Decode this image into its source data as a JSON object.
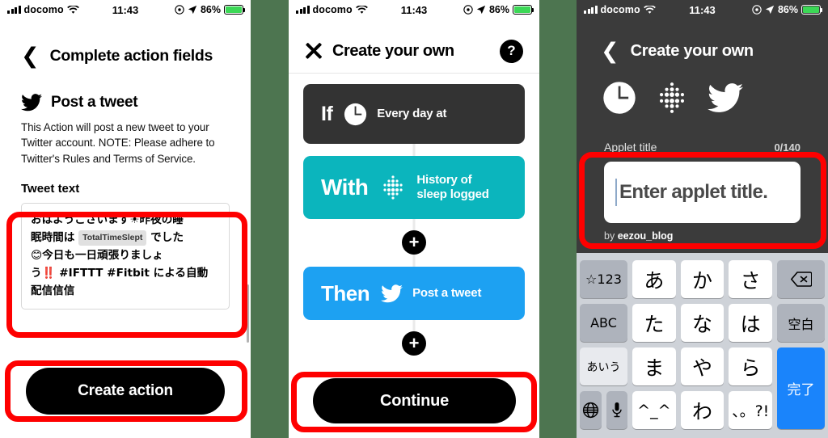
{
  "status_bar": {
    "carrier": "docomo",
    "time": "11:43",
    "battery_pct": "86%",
    "signal_icon": "cellular-bars-icon",
    "wifi_icon": "wifi-icon",
    "alarm_icon": "alarm-icon",
    "location_icon": "location-arrow-icon",
    "battery_icon": "battery-charging-icon"
  },
  "panel1": {
    "back_icon": "chevron-left-icon",
    "title": "Complete action fields",
    "service_icon": "twitter-bird-icon",
    "action_title": "Post a tweet",
    "description": "This Action will post a new tweet to your Twitter account. NOTE: Please adhere to Twitter's Rules and Terms of Service.",
    "field_label": "Tweet text",
    "tweet": {
      "line1_a": "おはようございます",
      "line1_sun": "☀",
      "line1_b": "昨夜の睡",
      "line2_a": "眠時間は",
      "ingredient": "TotalTimeSlept",
      "line2_b": "でした",
      "line3_emoji": "😊",
      "line3": "今日も一日頑張りましょ",
      "line4_a": "う",
      "line4_bangs": "‼️",
      "line4_b": "#IFTTT #Fitbit による自動",
      "line5": "配信信信"
    },
    "submit_label": "Create action"
  },
  "panel2": {
    "close_icon": "close-x-icon",
    "title": "Create your own",
    "help_label": "?",
    "cards": [
      {
        "keyword": "If",
        "service_icon": "clock-icon",
        "text": "Every day at",
        "color": "#333333"
      },
      {
        "keyword": "With",
        "service_icon": "fitbit-icon",
        "text": "History of\nsleep logged",
        "color": "#0bb5bd",
        "text_line1": "History of",
        "text_line2": "sleep logged"
      },
      {
        "keyword": "Then",
        "service_icon": "twitter-bird-icon",
        "text": "Post a tweet",
        "color": "#1da1f2"
      }
    ],
    "add_label": "+",
    "submit_label": "Continue"
  },
  "panel3": {
    "back_icon": "chevron-left-icon",
    "title": "Create your own",
    "service_icons": [
      "clock-icon",
      "fitbit-icon",
      "twitter-bird-icon"
    ],
    "field_label": "Applet title",
    "char_count": "0/140",
    "placeholder": "Enter applet title.",
    "byline_prefix": "by",
    "byline_user": "eezou_blog",
    "keyboard": {
      "row1": [
        "☆123",
        "あ",
        "か",
        "さ",
        "delete-icon"
      ],
      "row2": [
        "ABC",
        "た",
        "な",
        "は",
        "空白"
      ],
      "row3": [
        "あいう",
        "ま",
        "や",
        "ら",
        "完了"
      ],
      "row4": [
        "globe-icon",
        "microphone-icon",
        "^_^",
        "わ",
        "、。?!"
      ],
      "r1_keys": [
        "☆123",
        "あ",
        "か",
        "さ"
      ],
      "r2_keys": [
        "ABC",
        "た",
        "な",
        "は"
      ],
      "r2_space": "空白",
      "r3_keys": [
        "あいう",
        "ま",
        "や",
        "ら"
      ],
      "r3_done": "完了",
      "r4_keys": [
        "^_^",
        "わ",
        "、。?!"
      ]
    }
  },
  "annotations": {
    "color": "#fe0000",
    "boxes": [
      "tweet-text-field",
      "create-action-button",
      "continue-button",
      "applet-title-field"
    ]
  }
}
